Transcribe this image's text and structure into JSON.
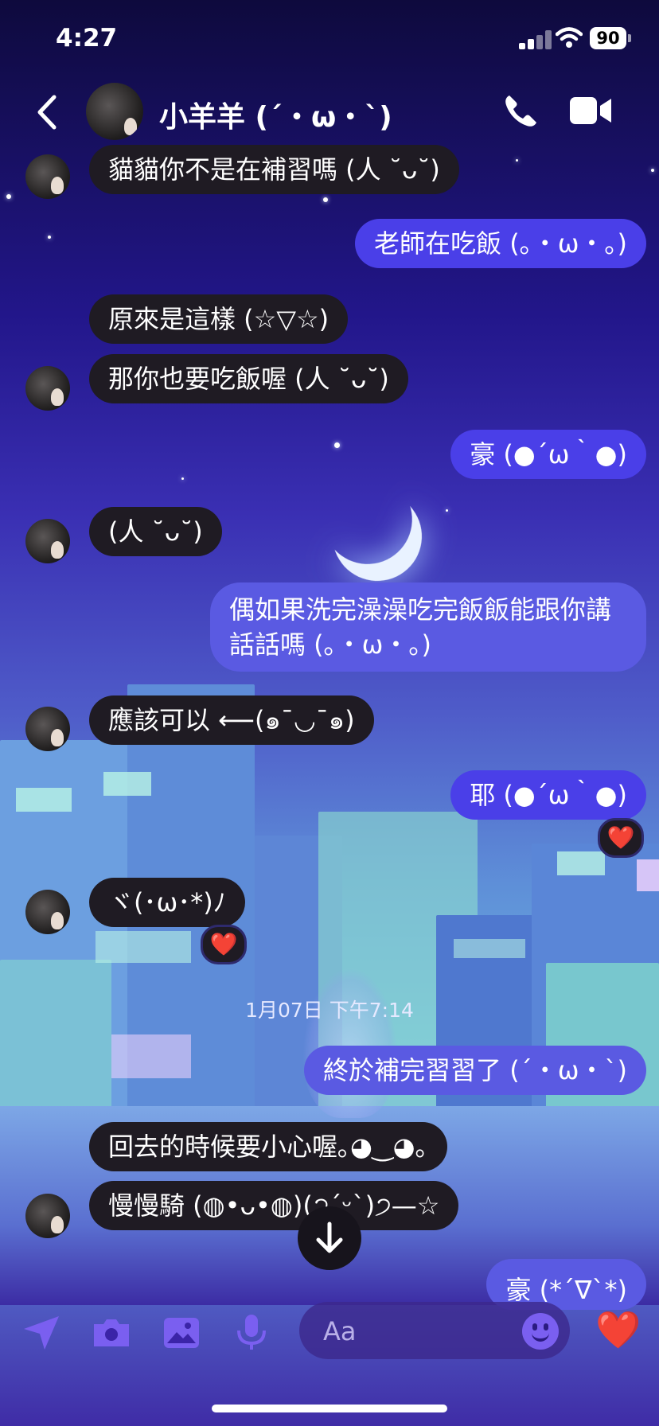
{
  "status_bar": {
    "time": "4:27",
    "battery": "90"
  },
  "header": {
    "contact_name": "小羊羊 (´・ω・`)"
  },
  "messages": [
    {
      "text": "貓貓你不是在補習嗎 (人 ˘ᴗ˘)"
    },
    {
      "text": "老師在吃飯 (｡・ω・｡)"
    },
    {
      "text": "原來是這樣 (☆▽☆)"
    },
    {
      "text": "那你也要吃飯喔 (人 ˘ᴗ˘)"
    },
    {
      "text": "豪 (●´ω｀●)"
    },
    {
      "text": "(人 ˘ᴗ˘)"
    },
    {
      "text": "偶如果洗完澡澡吃完飯飯能跟你講話話嗎 (｡・ω・｡)"
    },
    {
      "text": "應該可以 ⟵(๑¯◡¯๑)"
    },
    {
      "text": "耶 (●´ω｀●)"
    },
    {
      "text": "ヾ(･ω･*)ﾉ"
    },
    {
      "text": "終於補完習習了 (´・ω・`)"
    },
    {
      "text": "回去的時候要小心喔｡◕‿◕｡"
    },
    {
      "text": "慢慢騎 (◍•ᴗ•◍)(੭ˊᵕˋ)੭—☆"
    },
    {
      "text": "豪 (*´∇`*)"
    }
  ],
  "reactions": {
    "heart": "❤️"
  },
  "timestamp": "1月07日 下午7:14",
  "composer": {
    "placeholder": "Aa",
    "like": "❤️"
  },
  "icons": [
    "send-icon",
    "camera-icon",
    "gallery-icon",
    "microphone-icon",
    "emoji-icon",
    "heart-icon",
    "back-icon",
    "phone-icon",
    "video-icon",
    "arrow-down-icon"
  ]
}
